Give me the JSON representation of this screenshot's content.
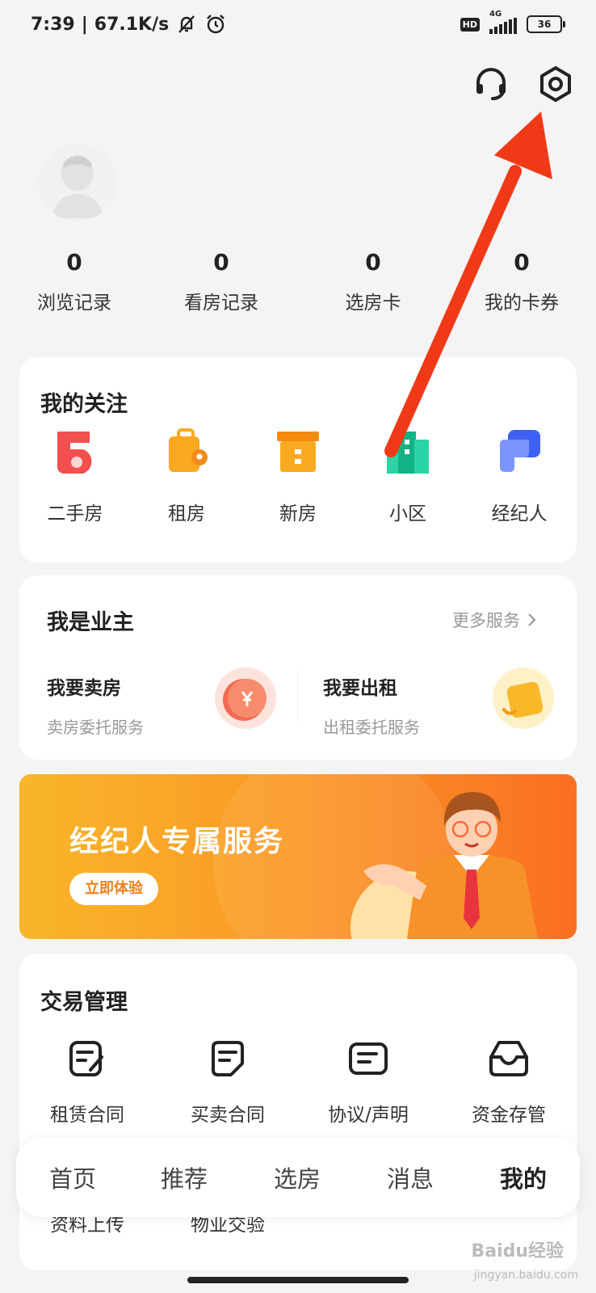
{
  "status_bar": {
    "time": "7:39",
    "speed": "67.1K/s",
    "hd": "HD",
    "network": "4G",
    "battery": "36"
  },
  "header": {
    "service_icon": "headset-icon",
    "settings_icon": "settings-hexagon-icon"
  },
  "profile": {
    "stats": [
      {
        "value": "0",
        "label": "浏览记录"
      },
      {
        "value": "0",
        "label": "看房记录"
      },
      {
        "value": "0",
        "label": "选房卡"
      },
      {
        "value": "0",
        "label": "我的卡券"
      }
    ]
  },
  "follow": {
    "title": "我的关注",
    "items": [
      {
        "label": "二手房",
        "icon": "second-hand-house-icon",
        "color": "#f1504e"
      },
      {
        "label": "租房",
        "icon": "rent-suitcase-icon",
        "color": "#f8a920"
      },
      {
        "label": "新房",
        "icon": "new-house-box-icon",
        "color": "#f7a21d"
      },
      {
        "label": "小区",
        "icon": "community-buildings-icon",
        "color": "#21c79a"
      },
      {
        "label": "经纪人",
        "icon": "agent-card-icon",
        "color": "#4a6cf7"
      }
    ]
  },
  "owner": {
    "title": "我是业主",
    "more": "更多服务",
    "sell": {
      "title": "我要卖房",
      "sub": "卖房委托服务"
    },
    "rent": {
      "title": "我要出租",
      "sub": "出租委托服务"
    }
  },
  "banner": {
    "title": "经纪人专属服务",
    "button": "立即体验"
  },
  "trade": {
    "title": "交易管理",
    "items": [
      {
        "label": "租赁合同",
        "icon": "lease-contract-icon"
      },
      {
        "label": "买卖合同",
        "icon": "sale-contract-icon"
      },
      {
        "label": "协议/声明",
        "icon": "agreement-icon"
      },
      {
        "label": "资金存管",
        "icon": "fund-custody-icon"
      },
      {
        "label": "资料上传",
        "icon": "upload-docs-icon"
      },
      {
        "label": "物业交验",
        "icon": "property-handover-icon"
      }
    ]
  },
  "nav": {
    "items": [
      "首页",
      "推荐",
      "选房",
      "消息",
      "我的"
    ],
    "active": "我的"
  },
  "watermark": {
    "brand": "Baidu经验",
    "url": "jingyan.baidu.com"
  },
  "colors": {
    "annotation_arrow": "#f03a17",
    "banner_orange": "#fb9825"
  }
}
